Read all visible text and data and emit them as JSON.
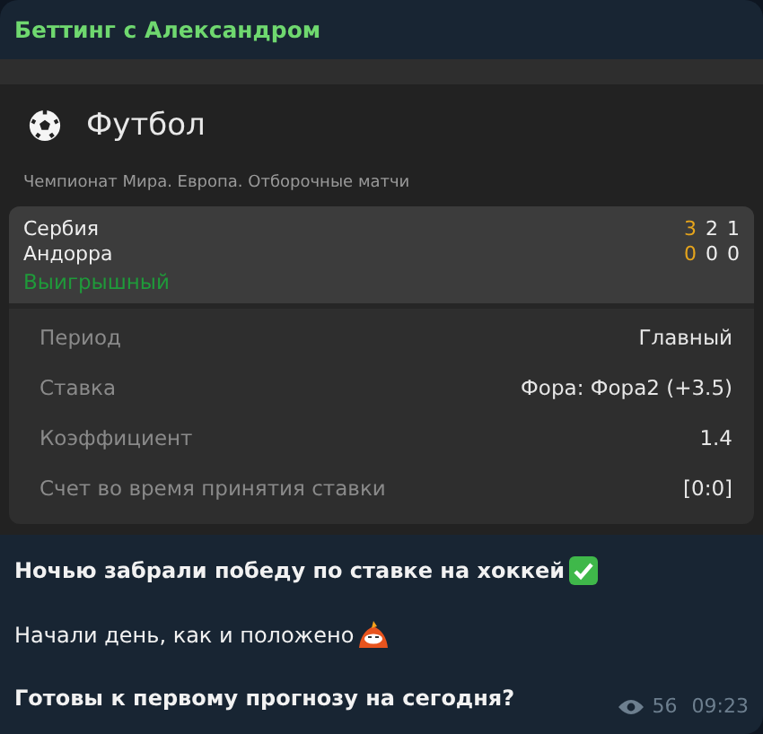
{
  "sender": "Беттинг с Александром",
  "sport": {
    "title": "Футбол",
    "league": "Чемпионат Мира. Европа. Отборочные матчи"
  },
  "teams": [
    {
      "name": "Сербия",
      "scores": [
        {
          "value": "3",
          "highlighted": true
        },
        {
          "value": "2",
          "highlighted": false
        },
        {
          "value": "1",
          "highlighted": false
        }
      ]
    },
    {
      "name": "Андорра",
      "scores": [
        {
          "value": "0",
          "highlighted": true
        },
        {
          "value": "0",
          "highlighted": false
        },
        {
          "value": "0",
          "highlighted": false
        }
      ]
    }
  ],
  "result": "Выигрышный",
  "details": [
    {
      "label": "Период",
      "value": "Главный"
    },
    {
      "label": "Ставка",
      "value": "Фора: Фора2 (+3.5)"
    },
    {
      "label": "Коэффициент",
      "value": "1.4"
    },
    {
      "label": "Счет во время принятия ставки",
      "value": "[0:0]"
    }
  ],
  "message": [
    {
      "text": "Ночью забрали победу по ставке на хоккей",
      "bold": true,
      "kind": "check"
    },
    {
      "text": "Начали день, как и положено",
      "bold": false,
      "kind": "emoji"
    },
    {
      "text": "Готовы к первому прогнозу на сегодня?",
      "bold": true,
      "kind": "plain"
    }
  ],
  "views": "56",
  "time": "09:23"
}
